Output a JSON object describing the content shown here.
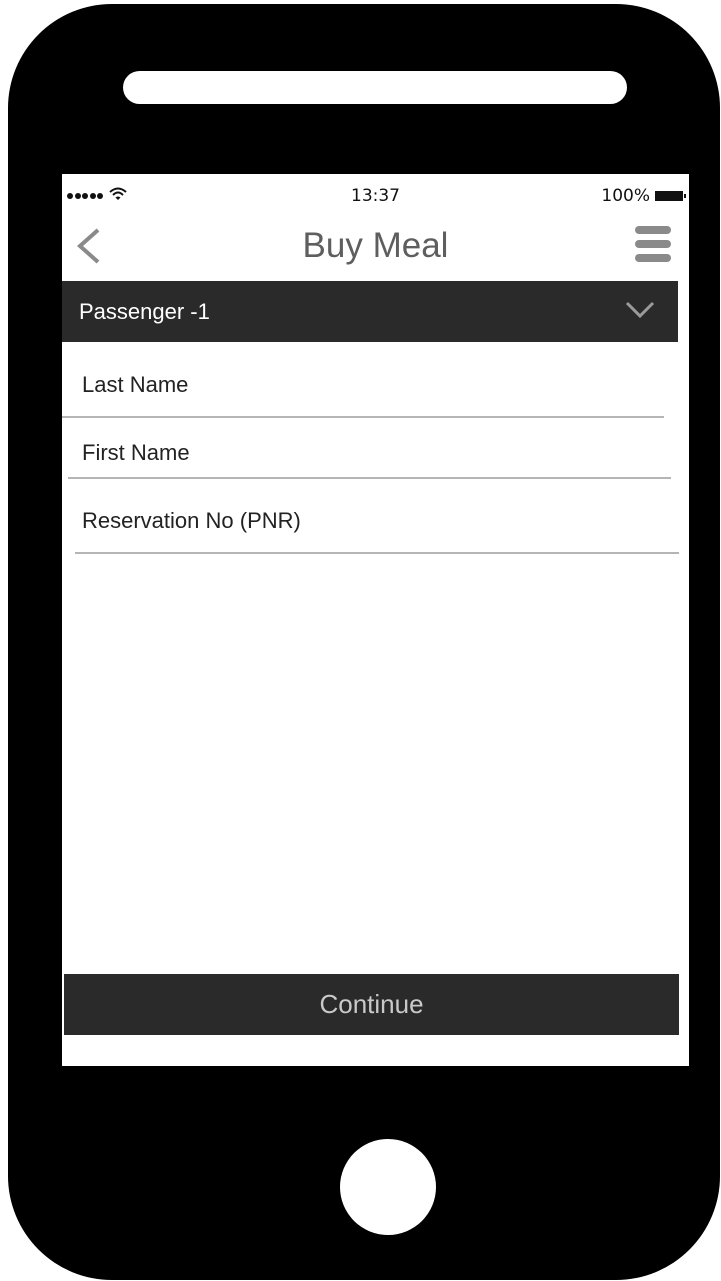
{
  "status_bar": {
    "time": "13:37",
    "battery_percent": "100%",
    "signal_dots": 5
  },
  "nav": {
    "title": "Buy Meal",
    "back_icon": "chevron-left-icon",
    "menu_icon": "hamburger-menu-icon"
  },
  "passenger_section": {
    "label": "Passenger -1",
    "toggle_icon": "chevron-down-icon"
  },
  "form": {
    "fields": [
      {
        "placeholder": "Last Name"
      },
      {
        "placeholder": "First Name"
      },
      {
        "placeholder": "Reservation No (PNR)"
      }
    ]
  },
  "actions": {
    "continue_label": "Continue"
  },
  "colors": {
    "bar_background": "#2a2a2a",
    "title_text": "#5e5e5e",
    "icon_gray": "#8a8a8a",
    "button_text": "#c9c9c9"
  }
}
